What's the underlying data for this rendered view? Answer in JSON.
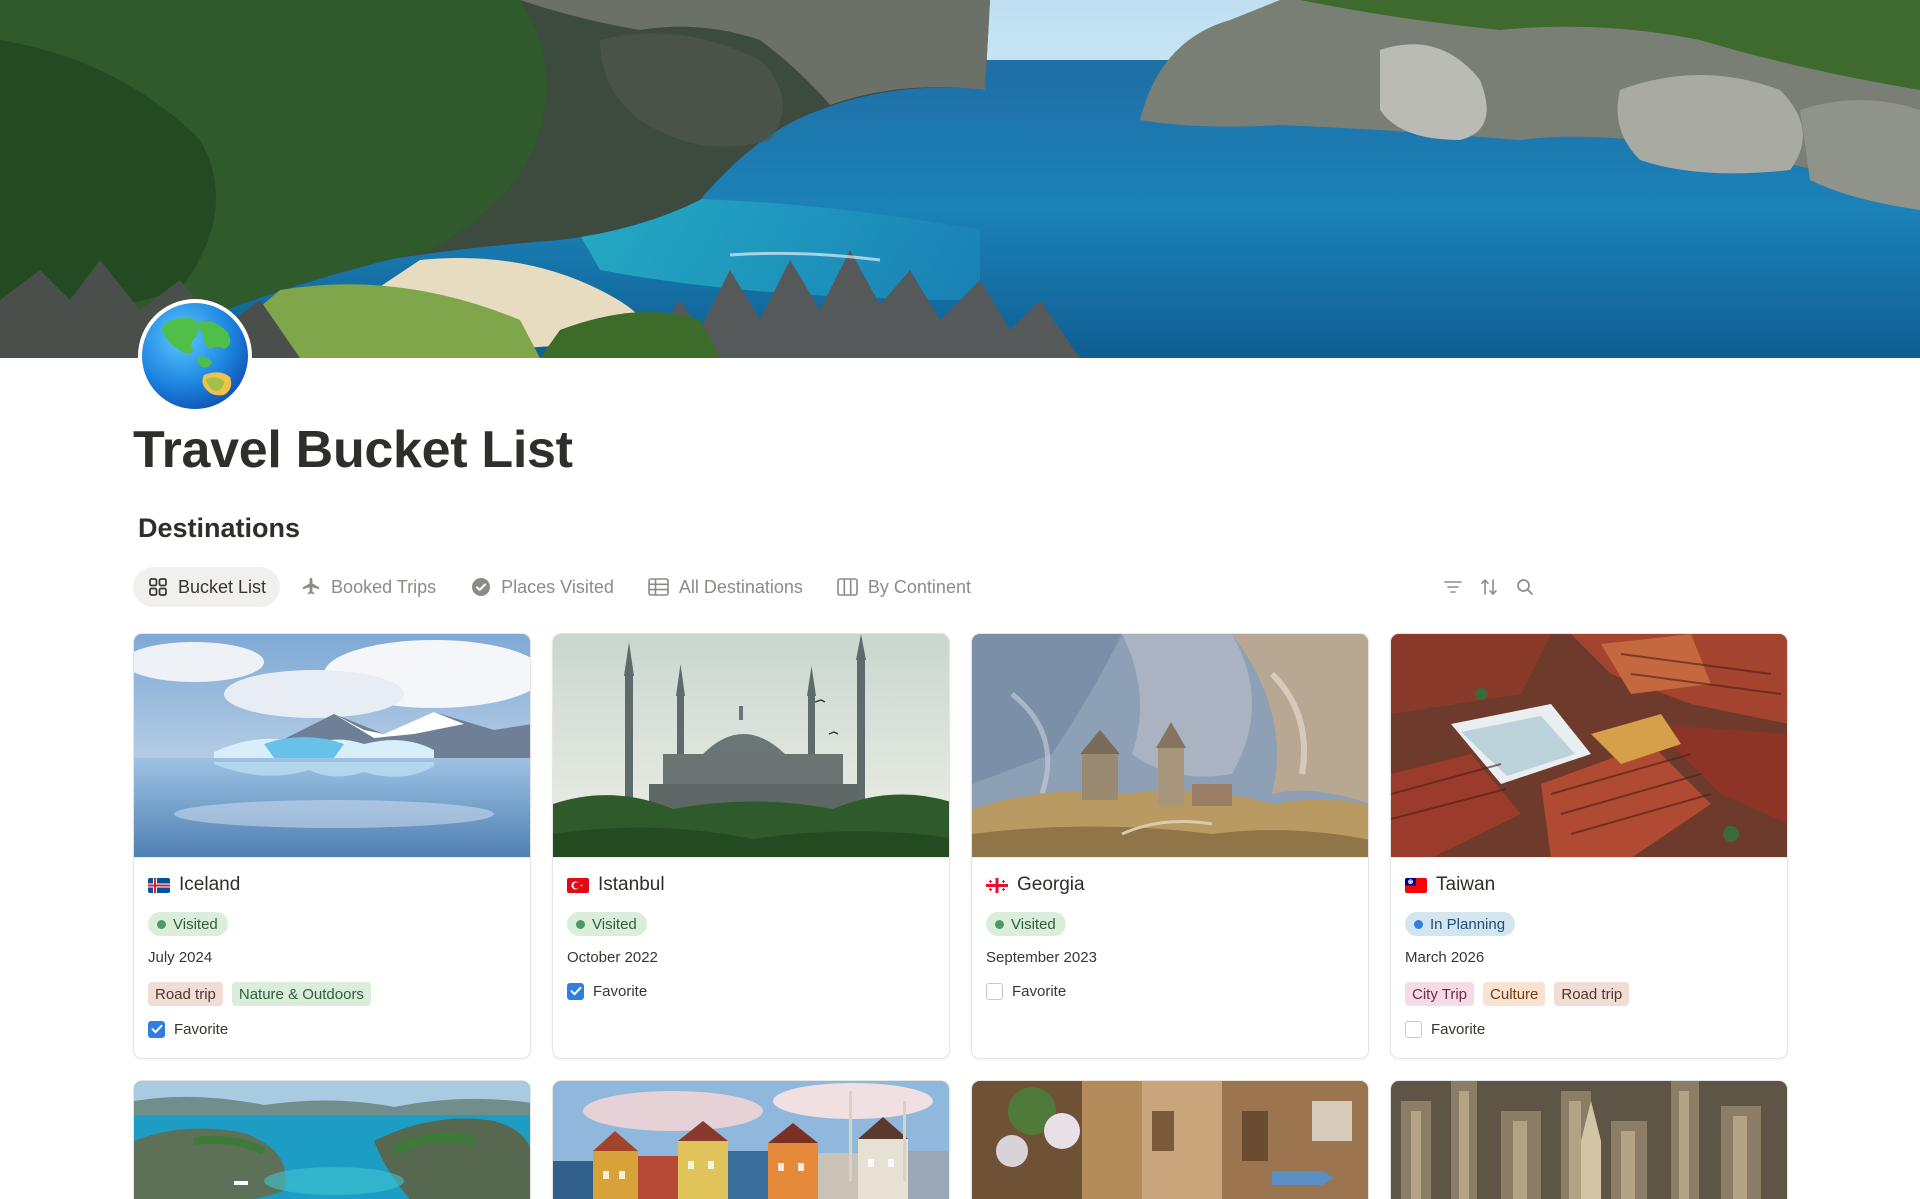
{
  "page": {
    "title": "Travel Bucket List",
    "icon": "globe-asia-australia-icon"
  },
  "database": {
    "title": "Destinations"
  },
  "views": [
    {
      "label": "Bucket List",
      "icon": "gallery-grid-icon",
      "active": true
    },
    {
      "label": "Booked Trips",
      "icon": "airplane-icon",
      "active": false
    },
    {
      "label": "Places Visited",
      "icon": "check-circle-icon",
      "active": false
    },
    {
      "label": "All Destinations",
      "icon": "table-icon",
      "active": false
    },
    {
      "label": "By Continent",
      "icon": "board-icon",
      "active": false
    }
  ],
  "toolbar": {
    "filter_icon": "filter-icon",
    "sort_icon": "sort-icon",
    "search_icon": "search-icon"
  },
  "cards": [
    {
      "name": "Iceland",
      "flag": "iceland-flag-icon",
      "status": "Visited",
      "date": "July 2024",
      "tags": [
        "Road trip",
        "Nature & Outdoors"
      ],
      "favorite_label": "Favorite",
      "favorite": true
    },
    {
      "name": "Istanbul",
      "flag": "turkey-flag-icon",
      "status": "Visited",
      "date": "October 2022",
      "tags": [],
      "favorite_label": "Favorite",
      "favorite": true
    },
    {
      "name": "Georgia",
      "flag": "georgia-flag-icon",
      "status": "Visited",
      "date": "September 2023",
      "tags": [],
      "favorite_label": "Favorite",
      "favorite": false
    },
    {
      "name": "Taiwan",
      "flag": "taiwan-flag-icon",
      "status": "In Planning",
      "date": "March 2026",
      "tags": [
        "City Trip",
        "Culture",
        "Road trip"
      ],
      "favorite_label": "Favorite",
      "favorite": false
    }
  ],
  "colors": {
    "status_visited_bg": "#dbeddb",
    "status_visited_dot": "#4c9a64",
    "status_visited_text": "#2d5f3a",
    "status_planning_bg": "#d3e5ef",
    "status_planning_dot": "#2f7ee0",
    "status_planning_text": "#1e4f7a",
    "tag_road_trip": "#f2ddd4",
    "tag_nature": "#dbeddb",
    "tag_city_trip": "#f5dbe5",
    "tag_culture": "#fae2d0",
    "checkbox_on": "#2f7ee0"
  }
}
